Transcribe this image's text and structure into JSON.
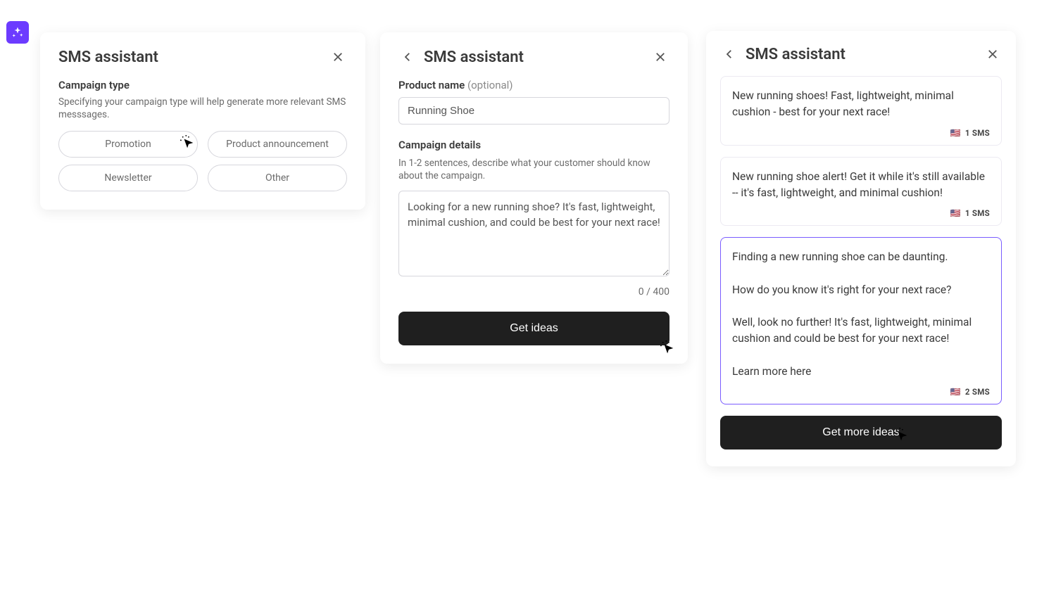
{
  "badge": {
    "name": "sparkle"
  },
  "panel1": {
    "title": "SMS assistant",
    "section_heading": "Campaign type",
    "section_desc": "Specifying your campaign type will help generate more relevant SMS messsages.",
    "options": [
      "Promotion",
      "Product announcement",
      "Newsletter",
      "Other"
    ]
  },
  "panel2": {
    "title": "SMS assistant",
    "product_label": "Product name",
    "product_optional": "(optional)",
    "product_value": "Running Shoe",
    "details_label": "Campaign details",
    "details_desc": "In 1-2 sentences, describe what your customer should know about the campaign.",
    "details_value": "Looking for a new running shoe? It's fast, lightweight, minimal cushion, and could be best for your next race!",
    "char_count": "0 / 400",
    "cta": "Get ideas"
  },
  "panel3": {
    "title": "SMS assistant",
    "ideas": [
      {
        "text": "New running shoes! Fast, lightweight, minimal cushion - best for your next race!",
        "sms": "1 SMS",
        "flag": "🇺🇸",
        "selected": false
      },
      {
        "text": "New running shoe alert! Get it while it's still available -- it's fast, lightweight, and minimal cushion!",
        "sms": "1 SMS",
        "flag": "🇺🇸",
        "selected": false
      },
      {
        "text": "Finding a new running shoe can be daunting.\n\nHow do you know it's right for your next race?\n\nWell, look no further! It's fast, lightweight, minimal cushion and could be best for your next race!\n\nLearn more here",
        "sms": "2 SMS",
        "flag": "🇺🇸",
        "selected": true
      }
    ],
    "cta": "Get more ideas"
  }
}
